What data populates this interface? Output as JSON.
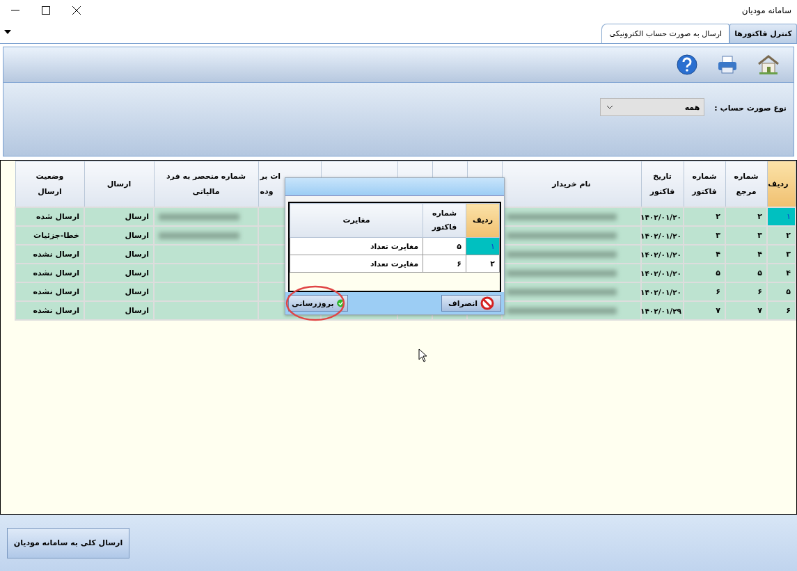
{
  "window": {
    "title": "سامانه مودیان"
  },
  "tabs": [
    {
      "label": "کنترل فاکتورها",
      "selected": false
    },
    {
      "label": "ارسال به صورت حساب الکترونیکی",
      "selected": true
    }
  ],
  "filter": {
    "label": "نوع صورت حساب :",
    "value": "همه"
  },
  "table": {
    "columns": [
      {
        "label": "ردیف",
        "kind": "index"
      },
      {
        "label": "شماره\nمرجع",
        "kind": "text"
      },
      {
        "label": "شماره\nفاکتور",
        "kind": "text"
      },
      {
        "label": "تاریخ\nفاکتور",
        "kind": "text"
      },
      {
        "label": "نام خریدار",
        "kind": "blur"
      },
      {
        "label": "ات بر\nوده",
        "kind": "empty"
      },
      {
        "label": "شماره منحصر به فرد\nمالیاتی",
        "kind": "blur"
      },
      {
        "label": "ارسال",
        "kind": "text"
      },
      {
        "label": "وضعیت ارسال",
        "kind": "text"
      }
    ],
    "rows": [
      {
        "selected": true,
        "cells": [
          "۱",
          "۲",
          "۲",
          "۱۴۰۲/۰۱/۲۰",
          "",
          "",
          "",
          "ارسال",
          "ارسال شده"
        ],
        "blurred": [
          true,
          true
        ]
      },
      {
        "selected": false,
        "cells": [
          "۲",
          "۳",
          "۳",
          "۱۴۰۲/۰۱/۲۰",
          "",
          "",
          "",
          "ارسال",
          "خطا-جزئیات"
        ],
        "blurred": [
          true,
          true
        ]
      },
      {
        "selected": false,
        "cells": [
          "۳",
          "۴",
          "۴",
          "۱۴۰۲/۰۱/۲۰",
          "",
          "",
          "",
          "ارسال",
          "ارسال نشده"
        ],
        "blurred": [
          true,
          false
        ]
      },
      {
        "selected": false,
        "cells": [
          "۴",
          "۵",
          "۵",
          "۱۴۰۲/۰۱/۲۰",
          "",
          "",
          "",
          "ارسال",
          "ارسال نشده"
        ],
        "blurred": [
          true,
          false
        ]
      },
      {
        "selected": false,
        "cells": [
          "۵",
          "۶",
          "۶",
          "۱۴۰۲/۰۱/۲۰",
          "",
          "",
          "",
          "ارسال",
          "ارسال نشده"
        ],
        "blurred": [
          true,
          false
        ]
      },
      {
        "selected": false,
        "cells": [
          "۶",
          "۷",
          "۷",
          "۱۴۰۲/۰۱/۲۹",
          "",
          "",
          "",
          "ارسال",
          "ارسال نشده"
        ],
        "blurred": [
          true,
          false
        ]
      }
    ]
  },
  "dialog": {
    "columns": [
      {
        "label": "ردیف",
        "kind": "index"
      },
      {
        "label": "شماره\nفاکتور",
        "kind": "text"
      },
      {
        "label": "مغایرت",
        "kind": "text"
      }
    ],
    "rows": [
      {
        "selected": true,
        "cells": [
          "۱",
          "۵",
          "مغایرت تعداد"
        ]
      },
      {
        "selected": false,
        "cells": [
          "۲",
          "۶",
          "مغایرت تعداد"
        ]
      }
    ],
    "buttons": [
      {
        "label": "انصراف",
        "kind": "cancel",
        "highlighted": false
      },
      {
        "label": "بروزرسانی",
        "kind": "ok",
        "highlighted": true
      }
    ]
  },
  "send_all_button": {
    "label": "ارسال کلی به سامانه مودیان"
  }
}
